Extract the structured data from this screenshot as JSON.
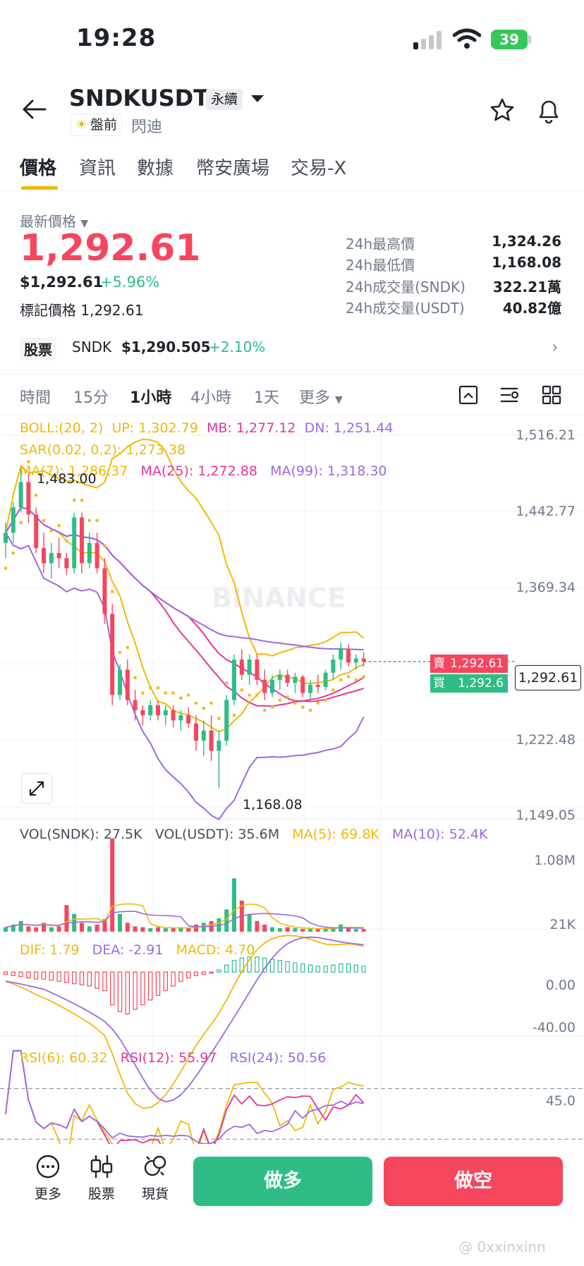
{
  "status": {
    "time": "19:28",
    "battery": "39"
  },
  "header": {
    "symbol": "SNDKUSDT",
    "contract": "永續",
    "premarket": "盤前",
    "alias": "閃迪"
  },
  "tabs": [
    {
      "label": "價格"
    },
    {
      "label": "資訊"
    },
    {
      "label": "數據"
    },
    {
      "label": "幣安廣場"
    },
    {
      "label": "交易-X"
    }
  ],
  "price": {
    "label": "最新價格",
    "last": "1,292.61",
    "usd": "$1,292.61",
    "change": "+5.96%",
    "mark_label": "標記價格",
    "mark": "1,292.61"
  },
  "stats": [
    {
      "label": "24h最高價",
      "value": "1,324.26"
    },
    {
      "label": "24h最低價",
      "value": "1,168.08"
    },
    {
      "label": "24h成交量(SNDK)",
      "value": "322.21萬"
    },
    {
      "label": "24h成交量(USDT)",
      "value": "40.82億"
    }
  ],
  "stock": {
    "tag": "股票",
    "ticker": "SNDK",
    "price": "$1,290.505",
    "change": "+2.10%"
  },
  "timeframes": [
    {
      "label": "時間"
    },
    {
      "label": "15分"
    },
    {
      "label": "1小時"
    },
    {
      "label": "4小時"
    },
    {
      "label": "1天"
    },
    {
      "label": "更多"
    }
  ],
  "indicators": {
    "boll": "BOLL:(20, 2)",
    "boll_up": "UP: 1,302.79",
    "boll_mb": "MB: 1,277.12",
    "boll_dn": "DN: 1,251.44",
    "sar": "SAR(0.02, 0.2): 1,273.38",
    "ma7": "MA(7): 1,286.37",
    "ma25": "MA(25): 1,272.88",
    "ma99": "MA(99): 1,318.30",
    "vol_sndk": "VOL(SNDK): 27.5K",
    "vol_usdt": "VOL(USDT): 35.6M",
    "vol_ma5": "MA(5): 69.8K",
    "vol_ma10": "MA(10): 52.4K",
    "dif": "DIF: 1.79",
    "dea": "DEA: -2.91",
    "macd": "MACD: 4.70",
    "rsi6": "RSI(6): 60.32",
    "rsi12": "RSI(12): 55.97",
    "rsi24": "RSI(24): 50.56"
  },
  "axis": {
    "price": [
      "1,516.21",
      "1,442.77",
      "1,369.34",
      "1,222.48",
      "1,149.05"
    ],
    "vol": [
      "1.08M",
      "21K"
    ],
    "macd": [
      "0.00",
      "-40.00"
    ],
    "rsi": [
      "45.0"
    ]
  },
  "chart_labels": {
    "high": "1,483.00",
    "low": "1,168.08",
    "current": "1,292.61",
    "sell_label": "賣",
    "sell_price": "1,292.61",
    "buy_label": "買",
    "buy_price": "1,292.6"
  },
  "watermark": "BINANCE",
  "nav": [
    {
      "label": "更多"
    },
    {
      "label": "股票"
    },
    {
      "label": "現貨"
    }
  ],
  "actions": {
    "long": "做多",
    "short": "做空"
  },
  "footer_watermark": "@ 0xxinxinn",
  "colors": {
    "up": "#2ebd85",
    "down": "#f6465d",
    "accent": "#f0b90b",
    "purple": "#9c6ade",
    "magenta": "#e1379a"
  },
  "chart_data": [
    {
      "type": "candlestick",
      "ylim": [
        1149.05,
        1516.21
      ],
      "ohlc": [
        [
          1410,
          1430,
          1395,
          1420
        ],
        [
          1420,
          1450,
          1410,
          1445
        ],
        [
          1445,
          1483,
          1440,
          1470
        ],
        [
          1470,
          1478,
          1430,
          1438
        ],
        [
          1438,
          1445,
          1400,
          1405
        ],
        [
          1405,
          1420,
          1380,
          1390
        ],
        [
          1390,
          1410,
          1375,
          1400
        ],
        [
          1400,
          1415,
          1385,
          1395
        ],
        [
          1395,
          1400,
          1378,
          1385
        ],
        [
          1385,
          1440,
          1380,
          1435
        ],
        [
          1435,
          1440,
          1380,
          1390
        ],
        [
          1390,
          1420,
          1385,
          1410
        ],
        [
          1410,
          1420,
          1380,
          1385
        ],
        [
          1385,
          1395,
          1330,
          1340
        ],
        [
          1340,
          1350,
          1250,
          1260
        ],
        [
          1260,
          1290,
          1255,
          1285
        ],
        [
          1285,
          1295,
          1250,
          1255
        ],
        [
          1255,
          1265,
          1235,
          1245
        ],
        [
          1245,
          1250,
          1230,
          1240
        ],
        [
          1240,
          1255,
          1235,
          1250
        ],
        [
          1250,
          1255,
          1235,
          1240
        ],
        [
          1240,
          1250,
          1230,
          1245
        ],
        [
          1245,
          1250,
          1228,
          1235
        ],
        [
          1235,
          1245,
          1225,
          1240
        ],
        [
          1240,
          1248,
          1228,
          1232
        ],
        [
          1232,
          1240,
          1205,
          1215
        ],
        [
          1215,
          1235,
          1200,
          1225
        ],
        [
          1225,
          1240,
          1195,
          1205
        ],
        [
          1205,
          1225,
          1168,
          1215
        ],
        [
          1215,
          1260,
          1210,
          1255
        ],
        [
          1255,
          1300,
          1250,
          1295
        ],
        [
          1295,
          1305,
          1275,
          1280
        ],
        [
          1280,
          1300,
          1270,
          1295
        ],
        [
          1295,
          1300,
          1270,
          1275
        ],
        [
          1275,
          1285,
          1255,
          1262
        ],
        [
          1262,
          1280,
          1258,
          1275
        ],
        [
          1275,
          1285,
          1265,
          1280
        ],
        [
          1280,
          1285,
          1268,
          1272
        ],
        [
          1272,
          1282,
          1262,
          1278
        ],
        [
          1278,
          1280,
          1258,
          1262
        ],
        [
          1262,
          1275,
          1255,
          1270
        ],
        [
          1270,
          1280,
          1262,
          1268
        ],
        [
          1268,
          1285,
          1265,
          1282
        ],
        [
          1282,
          1300,
          1275,
          1295
        ],
        [
          1295,
          1312,
          1285,
          1305
        ],
        [
          1305,
          1310,
          1288,
          1292
        ],
        [
          1292,
          1300,
          1285,
          1296
        ],
        [
          1296,
          1302,
          1288,
          1293
        ]
      ]
    },
    {
      "type": "bar",
      "name": "VOL",
      "ylim": [
        0,
        1.08
      ],
      "values": [
        0.05,
        0.08,
        0.12,
        0.06,
        0.05,
        0.1,
        0.05,
        0.06,
        0.3,
        0.2,
        0.1,
        0.06,
        0.08,
        0.14,
        1.05,
        0.2,
        0.1,
        0.06,
        0.05,
        0.04,
        0.05,
        0.04,
        0.04,
        0.05,
        0.04,
        0.08,
        0.1,
        0.12,
        0.15,
        0.25,
        0.6,
        0.35,
        0.2,
        0.12,
        0.08,
        0.05,
        0.04,
        0.05,
        0.04,
        0.03,
        0.03,
        0.03,
        0.04,
        0.05,
        0.08,
        0.04,
        0.03,
        0.03
      ]
    },
    {
      "type": "bar",
      "name": "MACD",
      "ylim": [
        -55,
        25
      ],
      "values": [
        -2,
        -3,
        -4,
        -5,
        -6,
        -6,
        -7,
        -8,
        -9,
        -10,
        -11,
        -12,
        -14,
        -16,
        -28,
        -34,
        -36,
        -32,
        -28,
        -24,
        -20,
        -16,
        -12,
        -8,
        -5,
        -3,
        -2,
        -1,
        2,
        6,
        10,
        12,
        13,
        13,
        12,
        11,
        10,
        9,
        8,
        7,
        6,
        5,
        5,
        6,
        7,
        7,
        6,
        5
      ]
    }
  ]
}
